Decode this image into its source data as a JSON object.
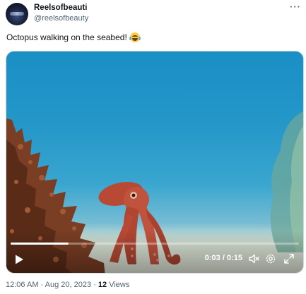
{
  "author": {
    "name": "Reelsofbeauti",
    "handle": "@reelsofbeauty"
  },
  "more_icon": "more-horizontal-icon",
  "tweet": {
    "text": "Octopus walking on the seabed!",
    "emoji": "face-with-tears-of-joy"
  },
  "video": {
    "current_time": "0:03",
    "separator": " / ",
    "duration": "0:15",
    "progress": 0.2,
    "icons": [
      "play-icon",
      "mute-icon",
      "settings-icon",
      "fullscreen-icon"
    ]
  },
  "meta": {
    "time": "12:06 AM",
    "dot": " · ",
    "date": "Aug 20, 2023",
    "dot2": " · ",
    "views_count": "12",
    "views_label": " Views"
  },
  "colors": {
    "text": "#0f1419",
    "secondary": "#536471",
    "water": "#1a8fc4",
    "octopus": "#c0533d"
  }
}
